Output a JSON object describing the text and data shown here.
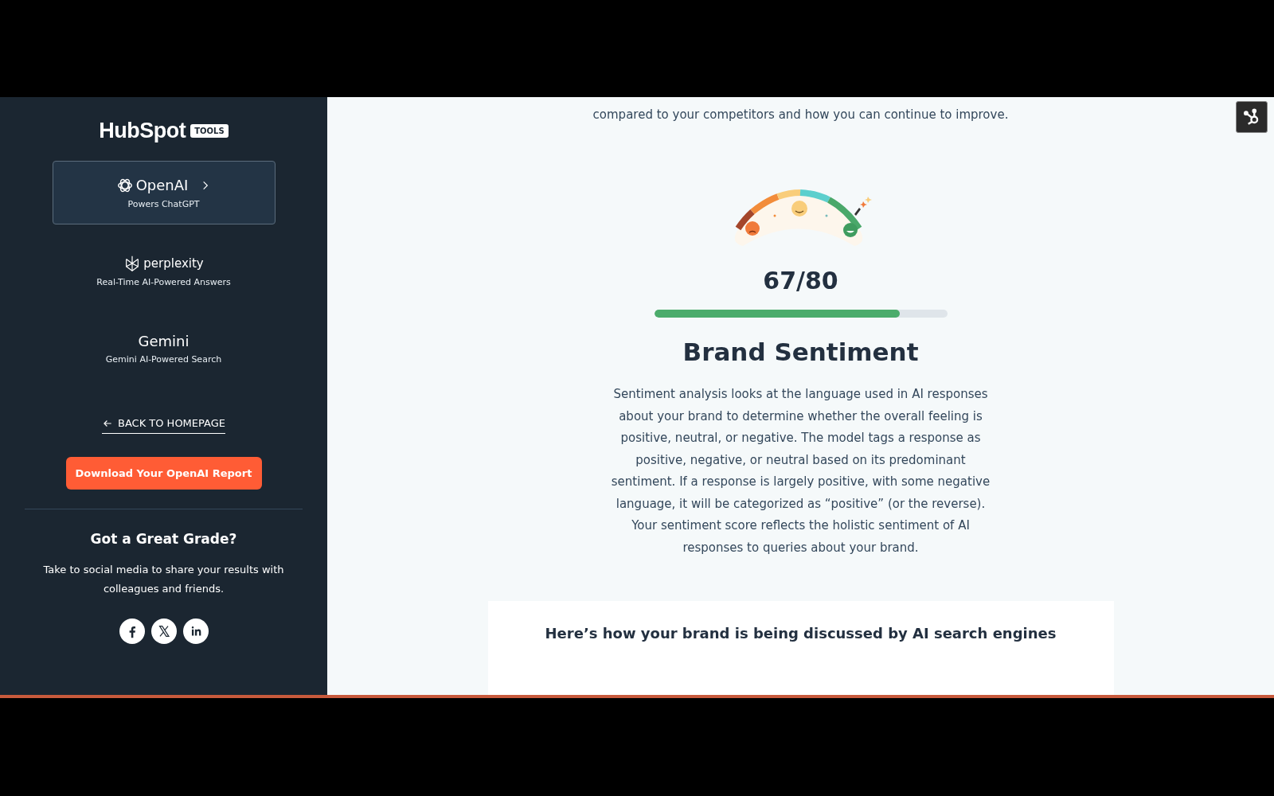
{
  "sidebar": {
    "logo": {
      "wordmark": "HubSpot",
      "badge": "TOOLS"
    },
    "engines": [
      {
        "kind": "openai",
        "name": "OpenAI",
        "subtitle": "Powers ChatGPT",
        "selected": true
      },
      {
        "kind": "perplexity",
        "name": "perplexity",
        "subtitle": "Real-Time AI-Powered Answers",
        "selected": false
      },
      {
        "kind": "gemini",
        "name": "Gemini",
        "subtitle": "Gemini AI-Powered Search",
        "selected": false
      }
    ],
    "back_link": "BACK TO HOMEPAGE",
    "download_button": "Download Your OpenAI Report",
    "share": {
      "title": "Got a Great Grade?",
      "text": "Take to social media to share your results with colleagues and friends.",
      "networks": [
        {
          "kind": "facebook"
        },
        {
          "kind": "x"
        },
        {
          "kind": "linkedin"
        }
      ]
    }
  },
  "main": {
    "intro": "compared to your competitors and how you can continue to improve.",
    "score": {
      "value": "67/80",
      "level": 0.8375
    },
    "title": "Brand Sentiment",
    "description": "Sentiment analysis looks at the language used in AI responses about your brand to determine whether the overall feeling is positive, neutral, or negative. The model tags a response as positive, negative, or neutral based on its predominant sentiment. If a response is largely positive, with some negative language, it will be categorized as “positive” (or the reverse). Your sentiment score reflects the holistic sentiment of AI responses to queries about your brand.",
    "card_title": "Here’s how your brand is being discussed by AI search engines"
  }
}
